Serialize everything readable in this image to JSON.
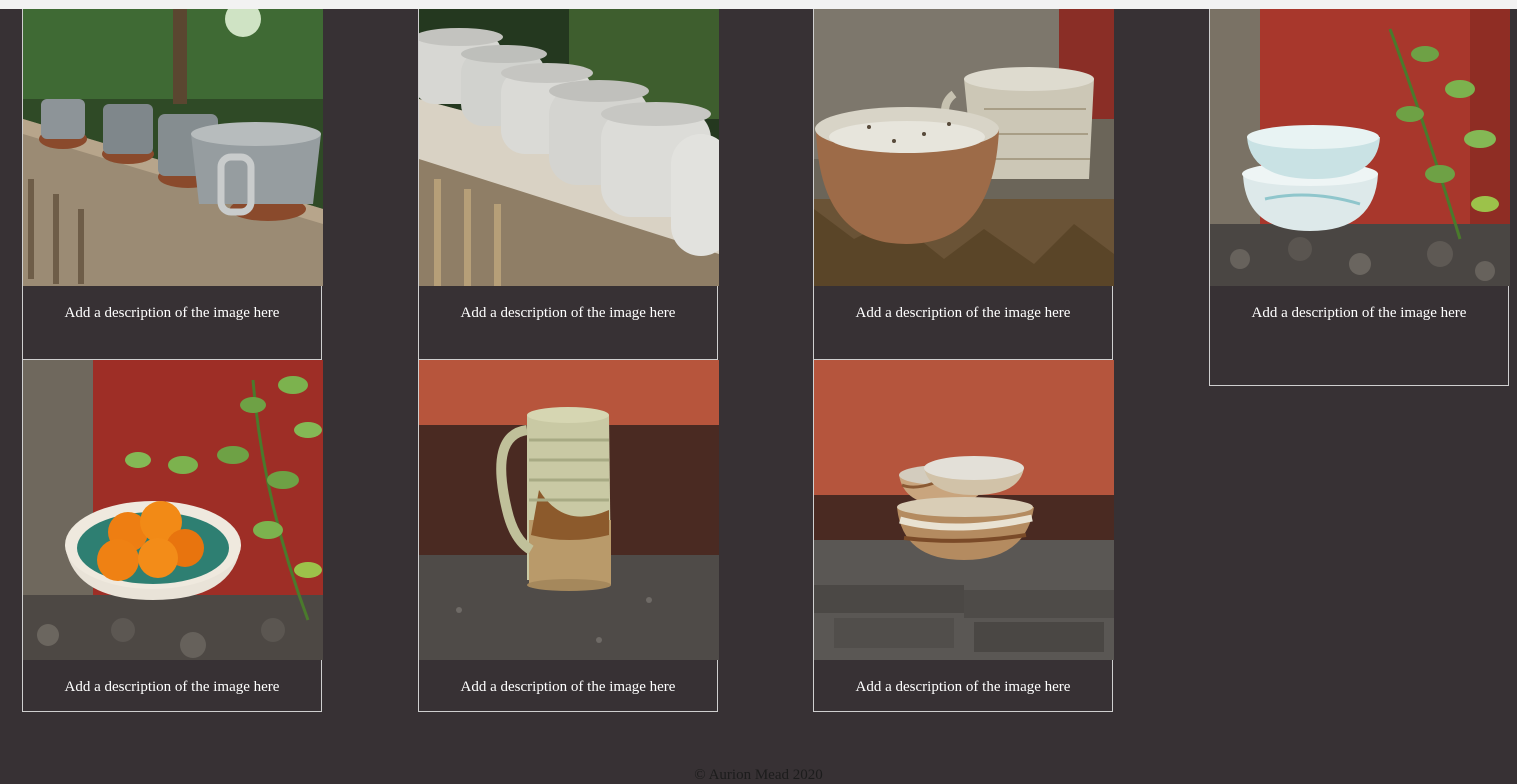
{
  "colors": {
    "page_background": "#373134",
    "card_border": "#cfcfcf",
    "caption_text": "#ffffff",
    "footer_text": "#1c1c1c"
  },
  "gallery": {
    "items": [
      {
        "caption": "Add a description of the image here",
        "photo": "mugs-on-wooden-railing"
      },
      {
        "caption": "Add a description of the image here",
        "photo": "white-mugs-on-railing"
      },
      {
        "caption": "Add a description of the image here",
        "photo": "speckled-bowl-and-mug"
      },
      {
        "caption": "Add a description of the image here",
        "photo": "stacked-blue-bowls"
      },
      {
        "caption": "Add a description of the image here",
        "photo": "bowl-with-apricots"
      },
      {
        "caption": "Add a description of the image here",
        "photo": "tall-green-mug"
      },
      {
        "caption": "Add a description of the image here",
        "photo": "nested-swirl-bowls"
      }
    ]
  },
  "footer": {
    "copyright": "© Aurion Mead 2020"
  }
}
